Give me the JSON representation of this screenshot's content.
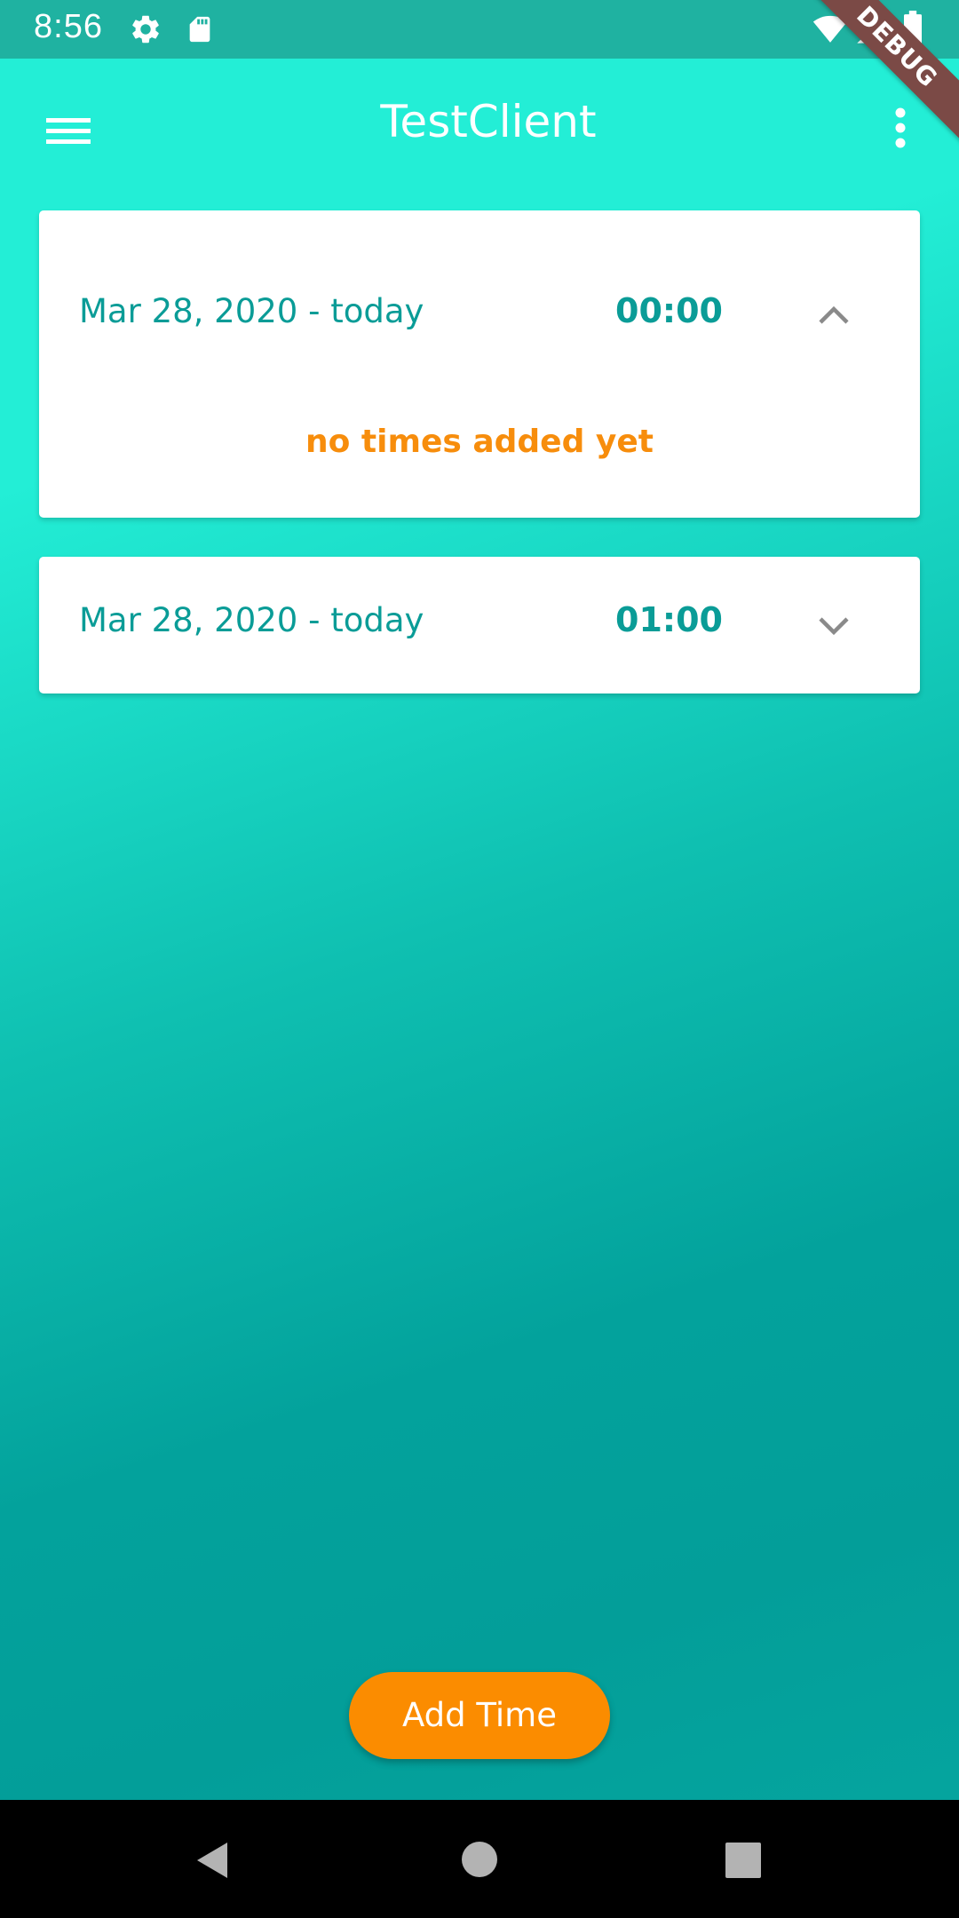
{
  "status_bar": {
    "time": "8:56",
    "icons": [
      "settings-gear-icon",
      "sd-card-icon",
      "wifi-icon",
      "cell-signal-icon",
      "battery-icon"
    ]
  },
  "debug_banner": {
    "label": "DEBUG"
  },
  "app_bar": {
    "title": "TestClient",
    "menu_icon": "hamburger-menu-icon",
    "overflow_icon": "more-vert-icon"
  },
  "cards": [
    {
      "range": "Mar 28, 2020 - today",
      "total": "00:00",
      "state": "expanded",
      "chevron_icon": "chevron-up-icon",
      "empty_message": "no times added yet"
    },
    {
      "range": "Mar 28, 2020 - today",
      "total": "01:00",
      "state": "collapsed",
      "chevron_icon": "chevron-down-icon"
    }
  ],
  "fab": {
    "label": "Add Time"
  },
  "nav_bar": {
    "icons": [
      "back-triangle-icon",
      "home-circle-icon",
      "recents-square-icon"
    ]
  },
  "colors": {
    "status_bar": "#1fb2a1",
    "gradient_top": "#23eed6",
    "gradient_bottom": "#039e99",
    "teal_text": "#0a9c97",
    "accent_orange": "#fb8c00",
    "debug_ribbon": "#7b4a46"
  }
}
